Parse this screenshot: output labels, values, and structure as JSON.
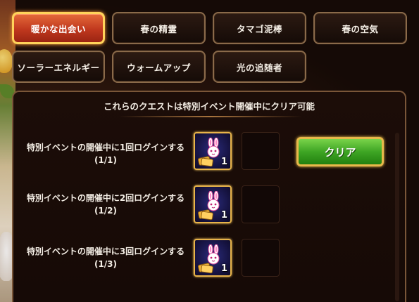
{
  "tabs": [
    {
      "label": "暖かな出会い",
      "active": true
    },
    {
      "label": "春の精霊",
      "active": false
    },
    {
      "label": "タマゴ泥棒",
      "active": false
    },
    {
      "label": "春の空気",
      "active": false
    },
    {
      "label": "ソーラーエネルギー",
      "active": false
    },
    {
      "label": "ウォームアップ",
      "active": false
    },
    {
      "label": "光の追随者",
      "active": false
    }
  ],
  "panel": {
    "title": "これらのクエストは特別イベント開催中にクリア可能"
  },
  "quests": [
    {
      "line1": "特別イベントの開催中に1回ログインする",
      "progress": "(1/1)",
      "reward_count": "1",
      "reward_icon": "bunny-ticket-icon"
    },
    {
      "line1": "特別イベントの開催中に2回ログインする",
      "progress": "(1/2)",
      "reward_count": "1",
      "reward_icon": "bunny-ticket-icon"
    },
    {
      "line1": "特別イベントの開催中に3回ログインする",
      "progress": "(1/3)",
      "reward_count": "1",
      "reward_icon": "bunny-ticket-icon"
    }
  ],
  "clear_button": {
    "label": "クリア"
  },
  "colors": {
    "active_tab": "#c0381e",
    "tab_border": "#8a6a4a",
    "gold_border": "#e8b44a",
    "clear_green": "#3ea524",
    "panel_bg": "#1c0d08"
  }
}
